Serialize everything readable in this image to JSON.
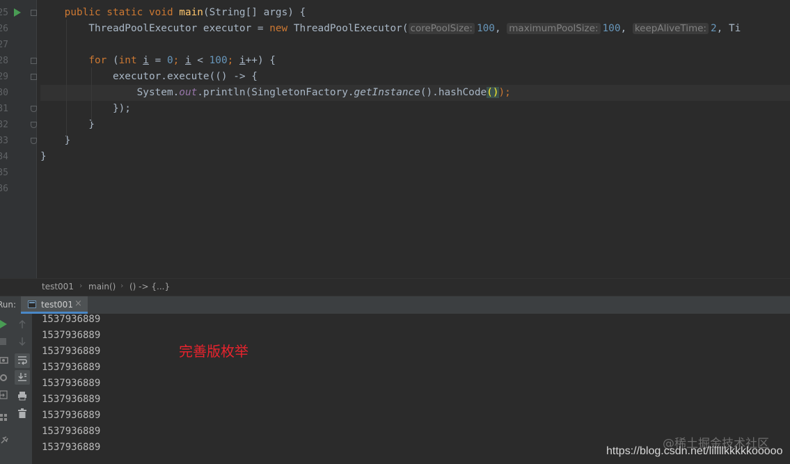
{
  "editor": {
    "line_numbers": [
      "25",
      "26",
      "27",
      "28",
      "29",
      "30",
      "31",
      "32",
      "33",
      "34",
      "35",
      "36"
    ],
    "lines": [
      {
        "segments": [
          {
            "t": "    "
          },
          {
            "t": "public static void ",
            "c": "kw"
          },
          {
            "t": "main",
            "c": "fn"
          },
          {
            "t": "(String[] args) {"
          }
        ]
      },
      {
        "segments": [
          {
            "t": "        ThreadPoolExecutor executor = "
          },
          {
            "t": "new ",
            "c": "kw"
          },
          {
            "t": "ThreadPoolExecutor("
          },
          {
            "t": "corePoolSize:",
            "c": "hint"
          },
          {
            "t": "100",
            "c": "num"
          },
          {
            "t": ", "
          },
          {
            "t": "maximumPoolSize:",
            "c": "hint"
          },
          {
            "t": "100",
            "c": "num"
          },
          {
            "t": ", "
          },
          {
            "t": "keepAliveTime:",
            "c": "hint"
          },
          {
            "t": "2",
            "c": "num"
          },
          {
            "t": ", Ti"
          }
        ]
      },
      {
        "segments": []
      },
      {
        "segments": [
          {
            "t": "        "
          },
          {
            "t": "for ",
            "c": "kw"
          },
          {
            "t": "("
          },
          {
            "t": "int ",
            "c": "kw"
          },
          {
            "t": "i",
            "c": "ul"
          },
          {
            "t": " = "
          },
          {
            "t": "0",
            "c": "num"
          },
          {
            "t": "; ",
            "c": "kw"
          },
          {
            "t": "i",
            "c": "ul"
          },
          {
            "t": " < "
          },
          {
            "t": "100",
            "c": "num"
          },
          {
            "t": "; ",
            "c": "kw"
          },
          {
            "t": "i",
            "c": "ul"
          },
          {
            "t": "++) {"
          }
        ]
      },
      {
        "segments": [
          {
            "t": "            executor.execute(() -> {"
          }
        ]
      },
      {
        "segments": [
          {
            "t": "                System."
          },
          {
            "t": "out",
            "c": "st"
          },
          {
            "t": ".println(SingletonFactory."
          },
          {
            "t": "getInstance",
            "c": "it"
          },
          {
            "t": "().hashCode"
          },
          {
            "t": "()",
            "c": "paren-hl"
          },
          {
            "t": ");",
            "c": "kw"
          }
        ]
      },
      {
        "segments": [
          {
            "t": "            });"
          }
        ]
      },
      {
        "segments": [
          {
            "t": "        }"
          }
        ]
      },
      {
        "segments": [
          {
            "t": "    }"
          }
        ]
      },
      {
        "segments": [
          {
            "t": "}"
          }
        ]
      },
      {
        "segments": []
      },
      {
        "segments": []
      }
    ]
  },
  "breadcrumb": {
    "items": [
      "test001",
      "main()",
      "() -> {...}"
    ]
  },
  "run": {
    "label": "Run:",
    "tab_label": "test001",
    "tab_close": "×",
    "output": [
      "1537936889",
      "1537936889",
      "1537936889",
      "1537936889",
      "1537936889",
      "1537936889",
      "1537936889",
      "1537936889",
      "1537936889"
    ],
    "annotation": "完善版枚举"
  },
  "watermarks": {
    "juejin": "@稀土掘金技术社区",
    "csdn": "https://blog.csdn.net/lillllkkkkkooooo"
  },
  "icons": {
    "gutter": [
      "run-icon"
    ],
    "left_toolbar": [
      "rerun-icon",
      "stop-icon",
      "camera-icon",
      "settings-icon",
      "login-icon",
      "layout-icon",
      "pin-icon"
    ],
    "right_toolbar": [
      "up-arrow-icon",
      "down-arrow-icon",
      "soft-wrap-icon",
      "scroll-to-end-icon",
      "print-icon",
      "trash-icon"
    ]
  },
  "colors": {
    "background": "#2b2b2b",
    "keyword": "#cc7832",
    "function": "#ffc66d",
    "number": "#6897bb",
    "static_field": "#9876aa",
    "annotation_text": "#e8232d"
  }
}
